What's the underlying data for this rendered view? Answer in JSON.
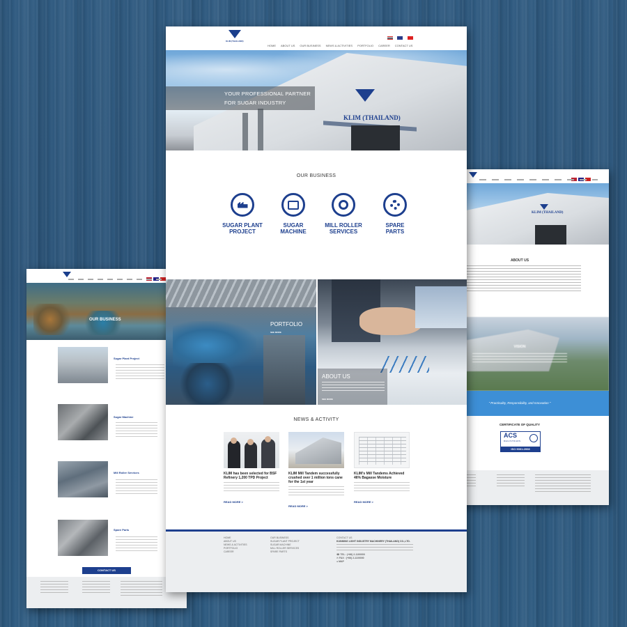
{
  "main_page": {
    "logo_text": "KLIM (THAILAND)",
    "nav": [
      "HOME",
      "ABOUT US",
      "OUR BUSINESS",
      "NEWS & ACTIVITIES",
      "PORTFOLIO",
      "CAREER",
      "CONTACT US"
    ],
    "hero": {
      "line1": "YOUR PROFESSIONAL PARTNER",
      "line2": "FOR SUGAR INDUSTRY",
      "building_sign": "KLIM (THAILAND)"
    },
    "business": {
      "heading": "OUR BUSINESS",
      "items": [
        {
          "label_1": "SUGAR PLANT",
          "label_2": "PROJECT",
          "icon": "factory-icon"
        },
        {
          "label_1": "SUGAR",
          "label_2": "MACHINE",
          "icon": "machine-icon"
        },
        {
          "label_1": "MILL ROLLER",
          "label_2": "SERVICES",
          "icon": "roller-icon"
        },
        {
          "label_1": "SPARE",
          "label_2": "PARTS",
          "icon": "gear-icon"
        }
      ]
    },
    "portfolio": {
      "title": "PORTFOLIO",
      "link": "SEE MORE"
    },
    "about": {
      "title": "ABOUT US",
      "link": "SEE MORE"
    },
    "news": {
      "heading": "NEWS & ACTIVITY",
      "items": [
        {
          "title": "KLIM has been selected for BSF Refinery 1,200 TPD Project",
          "read_more": "READ MORE >"
        },
        {
          "title": "KLIM Mill Tandem successfully crushed over 1 million tons cane for the 1st year",
          "read_more": "READ MORE >"
        },
        {
          "title": "KLIM's Mill Tandems Achieved 46% Bagasse Moisture",
          "read_more": "READ MORE >"
        }
      ]
    },
    "footer": {
      "col1": [
        "HOME",
        "ABOUT US",
        "NEWS & ACTIVITIES",
        "PORTFOLIO",
        "CAREER"
      ],
      "col2": [
        "OUR BUSINESS",
        "SUGAR PLANT PROJECT",
        "SUGAR MACHINE",
        "MILL ROLLER SERVICES",
        "SPARE PARTS"
      ],
      "col3_title": "CONTACT US",
      "col3_company": "KUNMING LIGHT INDUSTRY MACHINERY (THAILAND) CO.,LTD.",
      "tel": "TEL : (+66) 2-1100000",
      "fax": "FAX : (+66) 2-1100000",
      "map": "MAP"
    }
  },
  "left_page": {
    "hero_title": "OUR BUSINESS",
    "rows": [
      {
        "title": "Sugar Plant Project"
      },
      {
        "title": "Sugar Machine"
      },
      {
        "title": "Mill Roller Services"
      },
      {
        "title": "Spare Parts"
      }
    ],
    "contact_button": "CONTACT US"
  },
  "right_page": {
    "about_heading": "ABOUT US",
    "vision_heading": "VISION",
    "tagline": "\" Practicality, Responsibility, and Innovation \"",
    "certificate_heading": "CERTIFICATE OF QUALITY",
    "cert_logo": "ACS",
    "cert_sub": "REGISTRARS",
    "cert_iso": "ISO 9001:2008",
    "sign": "KLIM (THAILAND)"
  },
  "colors": {
    "brand": "#1d3f8e",
    "accent_blue": "#3d8fd6",
    "background": "#2d5a80"
  }
}
